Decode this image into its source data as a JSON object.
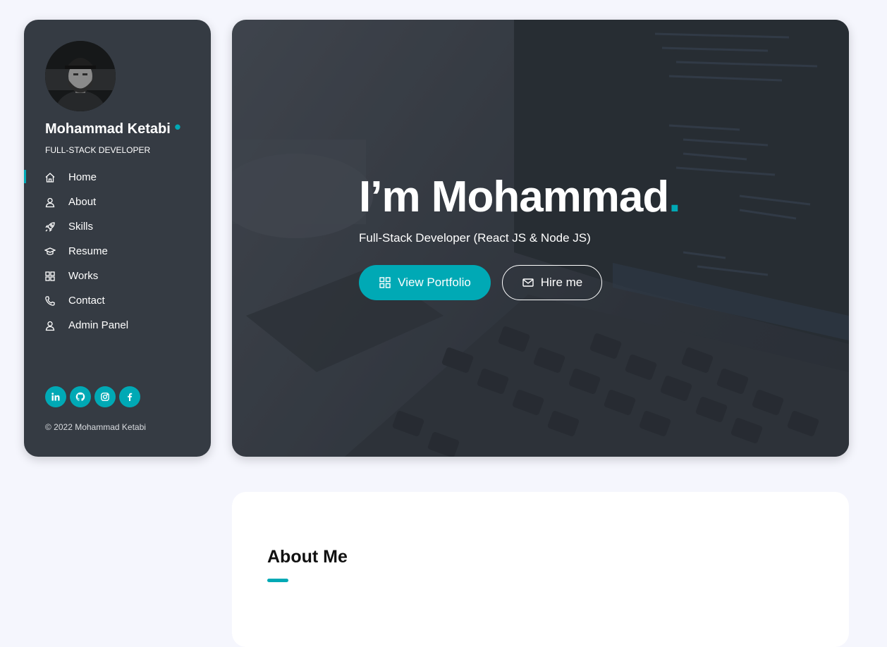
{
  "profile": {
    "name": "Mohammad Ketabi",
    "role": "FULL-STACK DEVELOPER"
  },
  "nav": [
    {
      "label": "Home",
      "icon": "home-icon",
      "active": true
    },
    {
      "label": "About",
      "icon": "user-icon"
    },
    {
      "label": "Skills",
      "icon": "rocket-icon"
    },
    {
      "label": "Resume",
      "icon": "graduation-cap-icon"
    },
    {
      "label": "Works",
      "icon": "grid-icon"
    },
    {
      "label": "Contact",
      "icon": "phone-icon"
    },
    {
      "label": "Admin Panel",
      "icon": "user-icon"
    }
  ],
  "socials": [
    "linkedin-icon",
    "github-icon",
    "instagram-icon",
    "facebook-icon"
  ],
  "footer": {
    "copyright": "© 2022 Mohammad Ketabi"
  },
  "hero": {
    "title": "I’m Mohammad",
    "subtitle": "Full-Stack Developer (React JS & Node JS)",
    "primary_button": "View Portfolio",
    "secondary_button": "Hire me"
  },
  "about": {
    "title": "About Me"
  },
  "colors": {
    "accent": "#00a9b5",
    "sidebar": "#353b43",
    "background": "#f5f6fd"
  }
}
